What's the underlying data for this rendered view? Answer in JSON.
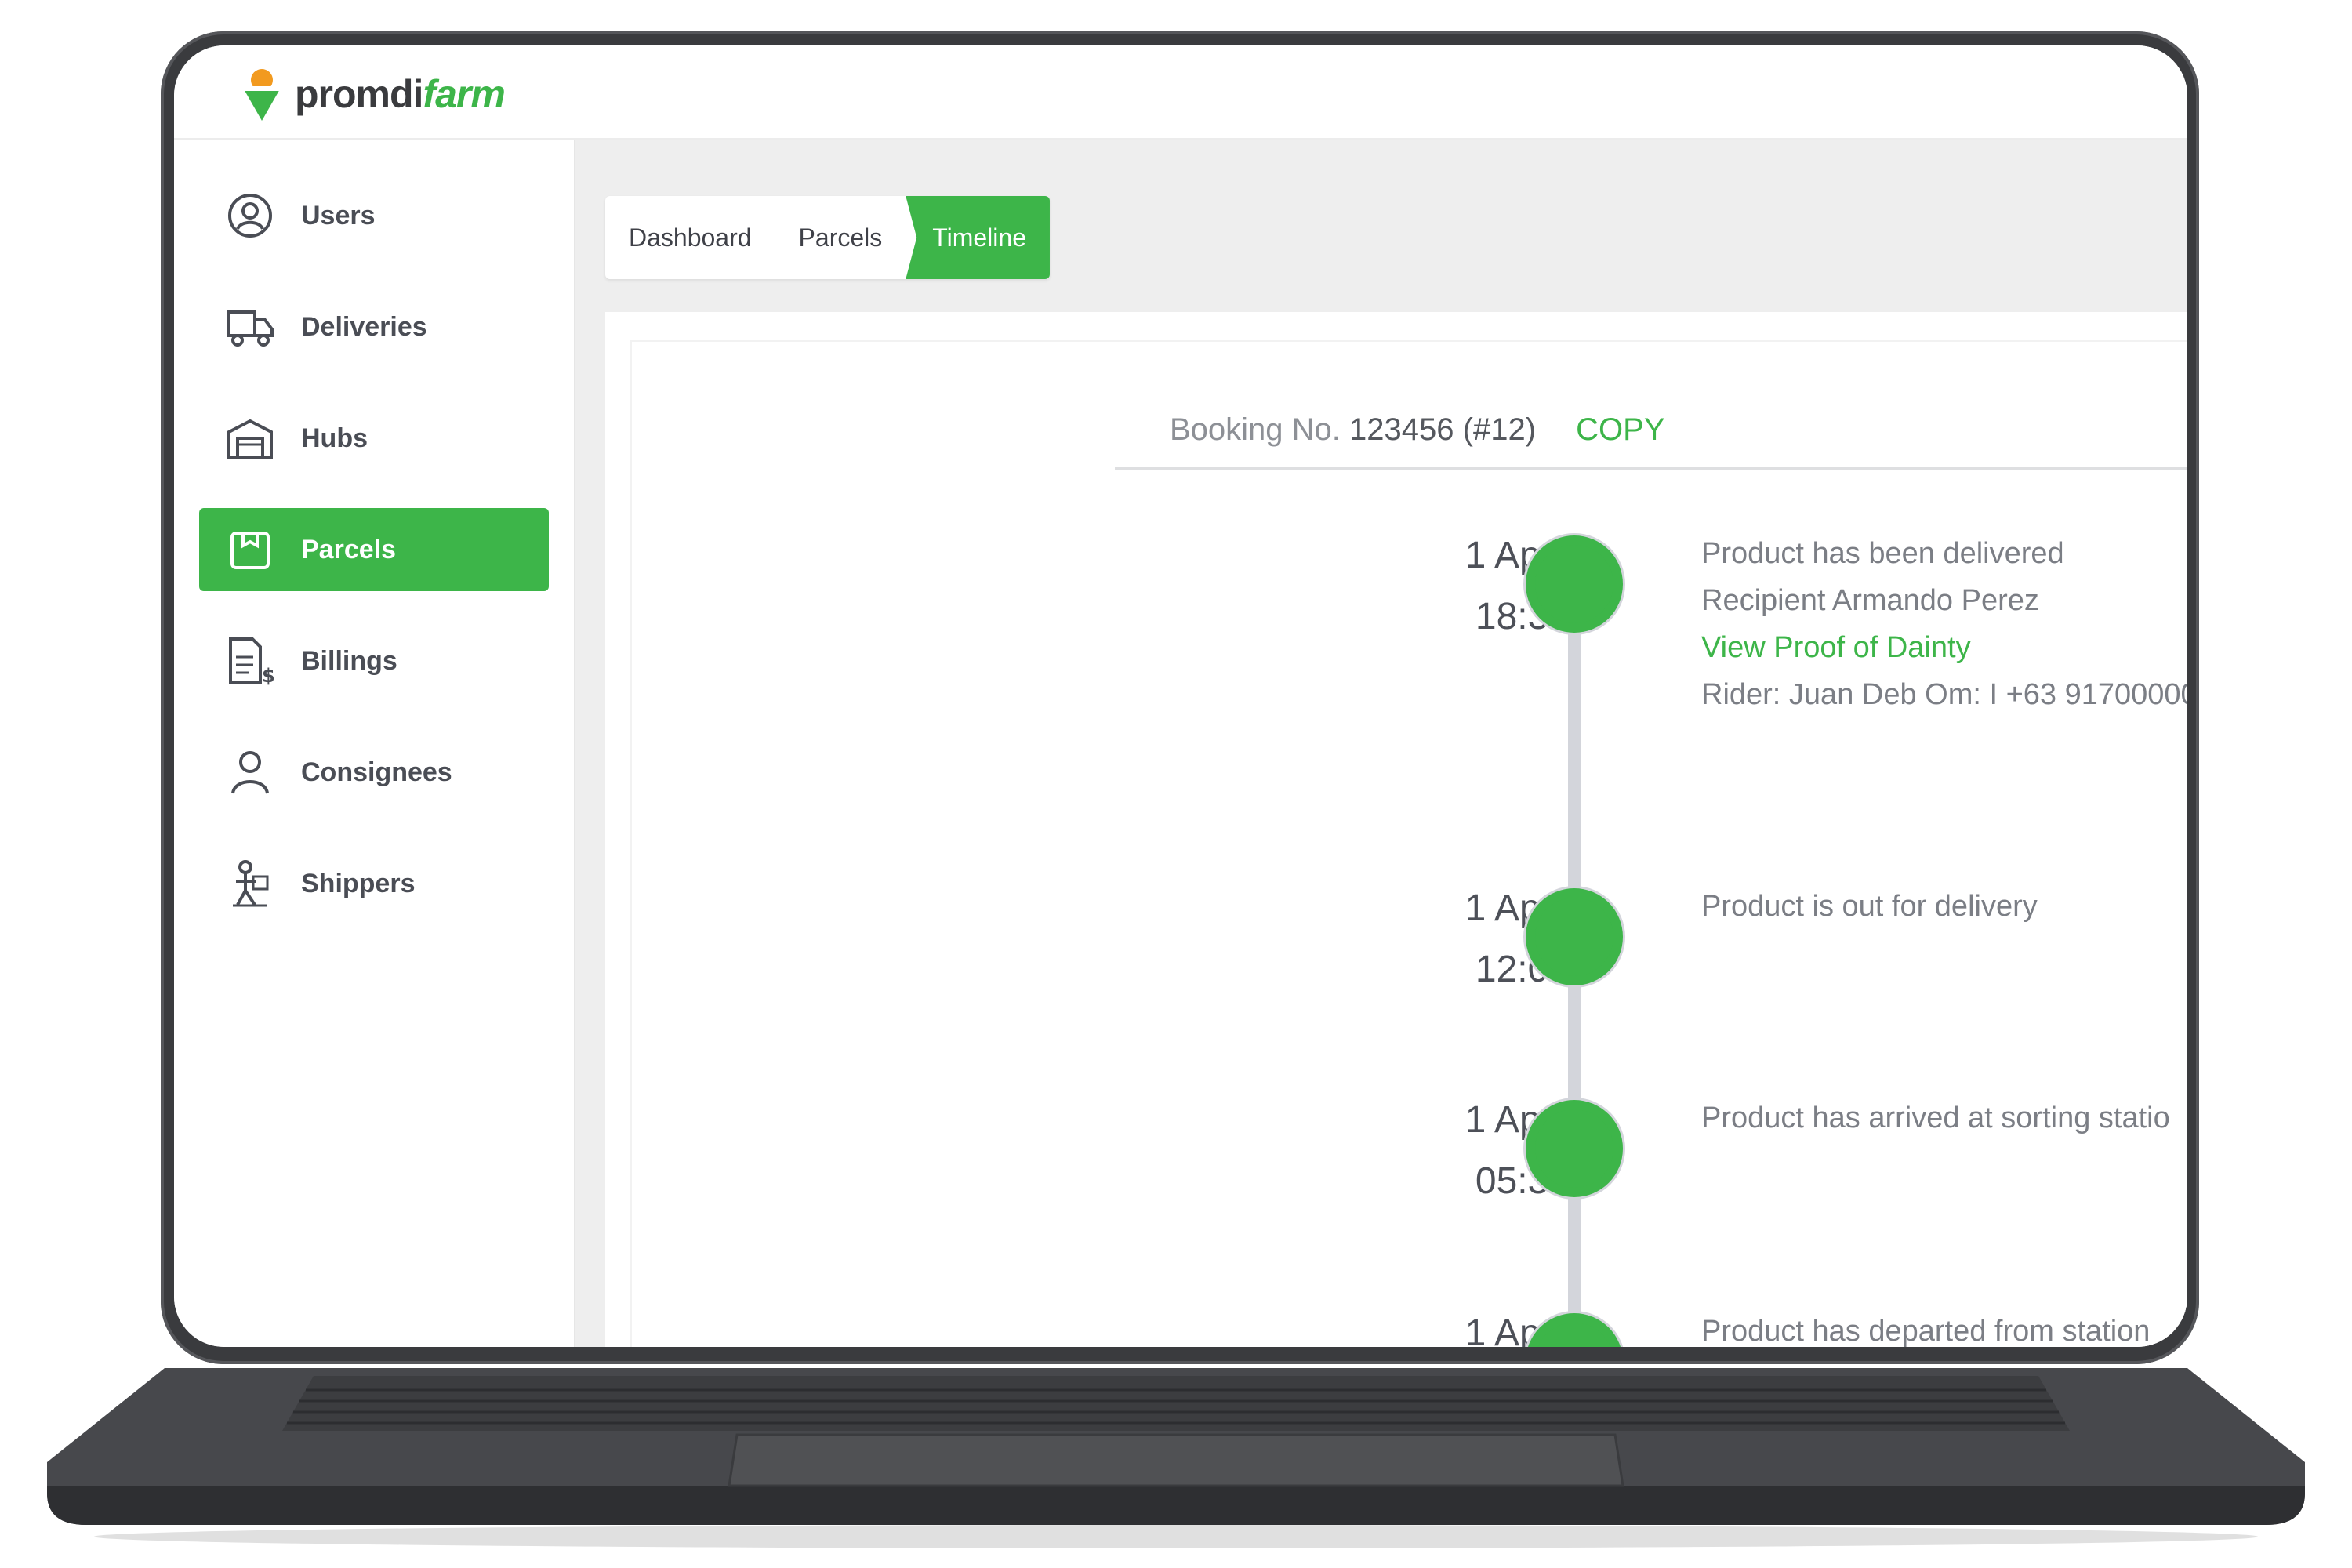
{
  "brand": {
    "name_dark": "promdi",
    "name_green": "farm"
  },
  "sidebar": {
    "items": [
      {
        "label": "Users",
        "icon": "user-circle-icon",
        "active": false
      },
      {
        "label": "Deliveries",
        "icon": "truck-icon",
        "active": false
      },
      {
        "label": "Hubs",
        "icon": "warehouse-icon",
        "active": false
      },
      {
        "label": "Parcels",
        "icon": "parcel-icon",
        "active": true
      },
      {
        "label": "Billings",
        "icon": "invoice-icon",
        "active": false
      },
      {
        "label": "Consignees",
        "icon": "person-icon",
        "active": false
      },
      {
        "label": "Shippers",
        "icon": "shipper-icon",
        "active": false
      }
    ]
  },
  "breadcrumb": [
    "Dashboard",
    "Parcels",
    "Timeline"
  ],
  "booking": {
    "label": "Booking No.",
    "number": "123456 (#12)",
    "copy_label": "COPY"
  },
  "timeline": [
    {
      "date": "1 April",
      "time": "18:30",
      "lines": [
        "Product has been delivered",
        "Recipient Armando Perez"
      ],
      "link": "View Proof of Dainty",
      "rider": "Rider: Juan Deb Om: I +63 91700000"
    },
    {
      "date": "1 April",
      "time": "12:04",
      "lines": [
        "Product is out for delivery"
      ]
    },
    {
      "date": "1 April",
      "time": "05:36",
      "lines": [
        "Product has arrived at sorting statio"
      ]
    },
    {
      "date": "1 April",
      "time": "",
      "lines": [
        "Product has departed from station"
      ]
    }
  ],
  "colors": {
    "accent": "#3db549",
    "text": "#4a4d55",
    "muted": "#7b7e85",
    "device": "#3a3b3e"
  }
}
